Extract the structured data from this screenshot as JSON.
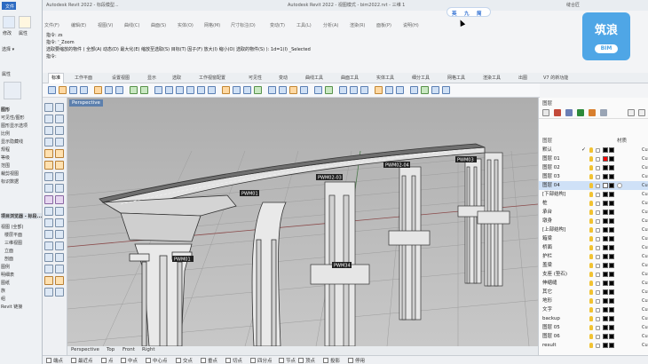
{
  "titlebar": {
    "left_text": "Autodesk Revit 2022 - 标段模型...",
    "center_text": "Autodesk Revit 2022 - 视图模式 - bim2022.rvt - 三维 1",
    "user": "缝合匠"
  },
  "revit": {
    "app_label": "文件",
    "panel_label": "属性",
    "select_label": "选择 ▾",
    "view_label": "修改",
    "property_label": "属性",
    "browser_title": "项目浏览器 - 标段...",
    "property_rows": [
      "图形",
      "可见性/图形",
      "图形显示选项",
      "比例",
      "显示隐藏线",
      "规程",
      "等级",
      "范围",
      "裁剪视图",
      "标识数据"
    ],
    "tree_rows": [
      "视图 (全部)",
      "楼层平面",
      "三维视图",
      "立面",
      "剖面",
      "图例",
      "明细表",
      "图纸",
      "族",
      "组",
      "Revit 链接"
    ]
  },
  "rhino": {
    "menu": [
      "文件(F)",
      "编辑(E)",
      "视图(V)",
      "曲线(C)",
      "曲面(S)",
      "实体(O)",
      "网格(M)",
      "尺寸标注(D)",
      "变动(T)",
      "工具(L)",
      "分析(A)",
      "渲染(R)",
      "面板(P)",
      "说明(H)"
    ],
    "cmd_lines": [
      "指令: zs",
      "指令: '_Zoom",
      "选取要缩放的物件 ( 全部(A)  动态(D)  最大化(E)  缩放至选取(S)  目标(T)  因子(F)  放大(I)  缩小(O)  选取的物件(S) ): 1d=1(I) _Selected",
      "指令:"
    ],
    "tabs": [
      "标准",
      "工作平面",
      "设置视图",
      "显示",
      "选取",
      "工作视窗配置",
      "可见性",
      "变动",
      "曲线工具",
      "曲面工具",
      "实体工具",
      "细分工具",
      "网格工具",
      "渲染工具",
      "出图",
      "V7 的新功能"
    ],
    "active_tab": 0
  },
  "viewport": {
    "title": "Perspective",
    "labels": [
      "PWM01",
      "PWM02-03",
      "PWM02-04",
      "PWM03",
      "PWM34"
    ],
    "tabs": [
      "Perspective",
      "Top",
      "Front",
      "Right"
    ]
  },
  "statusbar": {
    "items": [
      "端点",
      "最近点",
      "点",
      "中点",
      "中心点",
      "交点",
      "垂点",
      "切点",
      "四分点",
      "节点",
      "顶点",
      "投影",
      "停用"
    ]
  },
  "layers": {
    "panel_title": "图层",
    "col_name": "图层",
    "col_material": "材质",
    "rows": [
      {
        "name": "默认",
        "selected": false,
        "check": true,
        "color": "#000000"
      },
      {
        "name": "图层 01",
        "selected": false,
        "check": false,
        "color": "#ff0000"
      },
      {
        "name": "图层 02",
        "selected": false,
        "check": false,
        "color": "#000000"
      },
      {
        "name": "图层 03",
        "selected": false,
        "check": false,
        "color": "#000000"
      },
      {
        "name": "图层 04",
        "selected": true,
        "check": false,
        "color": "#ffffff"
      },
      {
        "name": "[下部结构]",
        "selected": false,
        "check": false,
        "color": "#000000"
      },
      {
        "name": "桩",
        "selected": false,
        "check": false,
        "color": "#000000"
      },
      {
        "name": "承台",
        "selected": false,
        "check": false,
        "color": "#000000"
      },
      {
        "name": "墩身",
        "selected": false,
        "check": false,
        "color": "#000000"
      },
      {
        "name": "[上部结构]",
        "selected": false,
        "check": false,
        "color": "#000000"
      },
      {
        "name": "箱梁",
        "selected": false,
        "check": false,
        "color": "#000000"
      },
      {
        "name": "桥面",
        "selected": false,
        "check": false,
        "color": "#000000"
      },
      {
        "name": "护栏",
        "selected": false,
        "check": false,
        "color": "#000000"
      },
      {
        "name": "盖梁",
        "selected": false,
        "check": false,
        "color": "#000000"
      },
      {
        "name": "支座 (垫石)",
        "selected": false,
        "check": false,
        "color": "#000000"
      },
      {
        "name": "伸缩缝",
        "selected": false,
        "check": false,
        "color": "#000000"
      },
      {
        "name": "其它",
        "selected": false,
        "check": false,
        "color": "#000000"
      },
      {
        "name": "地形",
        "selected": false,
        "check": false,
        "color": "#000000"
      },
      {
        "name": "文字",
        "selected": false,
        "check": false,
        "color": "#000000"
      },
      {
        "name": "backup",
        "selected": false,
        "check": false,
        "color": "#000000"
      },
      {
        "name": "图层 05",
        "selected": false,
        "check": false,
        "color": "#000000"
      },
      {
        "name": "图层 06",
        "selected": false,
        "check": false,
        "color": "#000000"
      },
      {
        "name": "result",
        "selected": false,
        "check": false,
        "color": "#000000"
      }
    ],
    "mat_label": "Cu"
  },
  "bim_logo": {
    "big": "筑浪",
    "small": "BIM"
  },
  "ime": {
    "a": "英",
    "b": "九",
    "c": "简"
  }
}
